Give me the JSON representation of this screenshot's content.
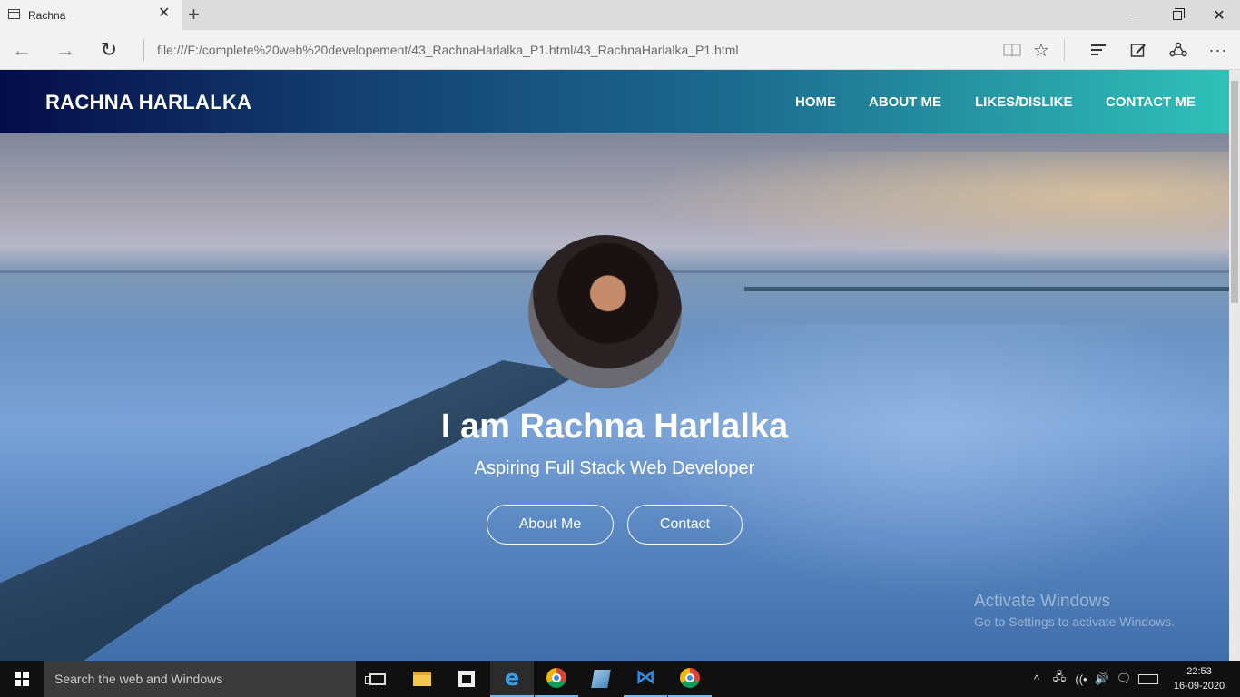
{
  "browser": {
    "tab_title": "Rachna",
    "tab_close": "✕",
    "new_tab": "+",
    "url": "file:///F:/complete%20web%20developement/43_RachnaHarlalka_P1.html/43_RachnaHarlalka_P1.html",
    "back": "←",
    "forward": "→",
    "refresh": "↻",
    "favorite": "☆",
    "more": "···",
    "close": "✕"
  },
  "site": {
    "brand": "RACHNA HARLALKA",
    "nav": {
      "home": "HOME",
      "about": "ABOUT ME",
      "likes": "LIKES/DISLIKE",
      "contact": "CONTACT ME"
    },
    "hero": {
      "title": "I am Rachna Harlalka",
      "subtitle": "Aspiring Full Stack Web Developer",
      "btn_about": "About Me",
      "btn_contact": "Contact"
    },
    "colors": {
      "nav_start": "#050c4a",
      "nav_end": "#2fc1b8"
    }
  },
  "watermark": {
    "title": "Activate Windows",
    "subtitle": "Go to Settings to activate Windows."
  },
  "taskbar": {
    "search_placeholder": "Search the web and Windows",
    "time": "22:53",
    "date": "16-09-2020",
    "edge_glyph": "e",
    "vscode_glyph": "⋈",
    "tray_up": "^",
    "network": "🖧",
    "wifi": "((•",
    "volume": "🔊",
    "messages": "🗨"
  }
}
